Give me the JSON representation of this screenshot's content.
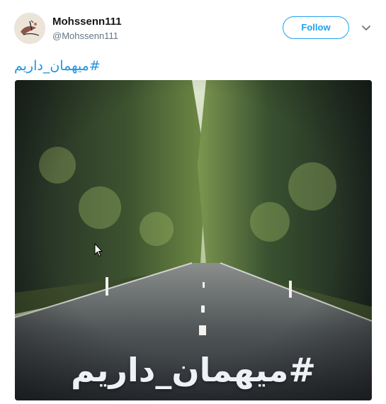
{
  "tweet": {
    "user": {
      "display_name": "Mohssenn111",
      "handle": "@Mohssenn111"
    },
    "follow_label": "Follow",
    "menu_icon": "chevron-down-icon",
    "text": "#میهمان_داریم",
    "media": {
      "overlay_text": "#میهمان_داریم"
    }
  },
  "colors": {
    "accent": "#1da1f2",
    "hashtag": "#1b95e0",
    "secondary_text": "#657786"
  }
}
